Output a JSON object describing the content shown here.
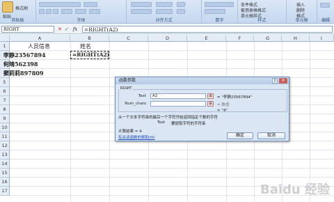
{
  "ribbon": {
    "clipboard": {
      "paste_label": "粘贴",
      "format_painter_label": "格式刷",
      "group_label": "剪贴板"
    },
    "font": {
      "group_label": "字体"
    },
    "alignment": {
      "group_label": "对齐方式"
    },
    "number": {
      "group_label": "数字"
    },
    "styles": {
      "group_label": "样式",
      "conditional_label": "条件格式",
      "table_label": "套用表格格式",
      "cell_style_label": "单元格样式"
    },
    "cells": {
      "group_label": "单元格",
      "insert_label": "插入",
      "delete_label": "删除",
      "format_label": "格式"
    },
    "editing": {
      "group_label": "编辑"
    }
  },
  "formula_bar": {
    "name_box": "RIGHT",
    "cancel_icon": "✕",
    "enter_icon": "✓",
    "fx_label": "fx",
    "formula": "=RIGHT(A2)"
  },
  "columns": [
    "A",
    "B",
    "C",
    "D",
    "E",
    "F",
    "G",
    "H",
    "I"
  ],
  "rows": [
    "1",
    "2",
    "3",
    "4",
    "5",
    "6",
    "7",
    "8",
    "9",
    "10",
    "11",
    "12",
    "13",
    "14",
    "15",
    "16",
    "17"
  ],
  "cells": {
    "a1": "人员信息",
    "b1": "姓名",
    "a2": "李静23567894",
    "b2": "=RIGHT(A2)",
    "a3": "何晴562398",
    "a4": "窦莉莉897809"
  },
  "dialog": {
    "title": "函数参数",
    "close": "✕",
    "help_q": "?",
    "function_name": "RIGHT",
    "args": [
      {
        "name": "Text",
        "value": "A2",
        "btn": "⊞",
        "result": "= \"李静23567894\""
      },
      {
        "name": "Num_chars",
        "value": "",
        "btn": "⊞",
        "result": "= 数值"
      }
    ],
    "overall_result": "= \"4\"",
    "description": "从一个文本字符串的最后一个字符开始返回指定个数的字符",
    "arg_desc_name": "Text",
    "arg_desc": "要提取字符的字符串",
    "calc_result": "计算结果 = 4",
    "help_link": "有关该函数的帮助(H)",
    "ok": "确定",
    "cancel": "取消"
  },
  "watermark": "Baidu 经验"
}
